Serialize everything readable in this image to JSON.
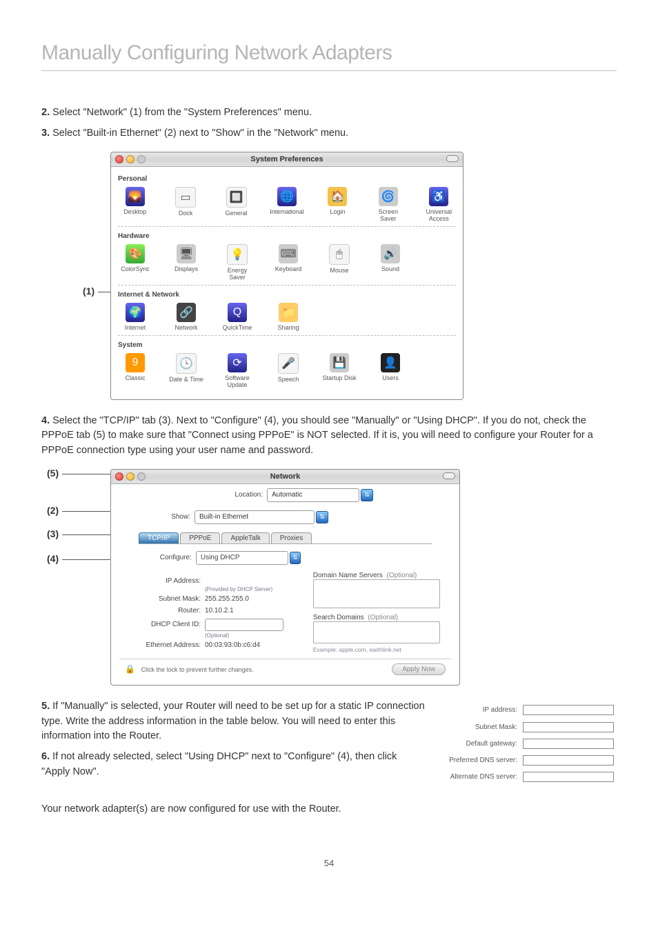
{
  "page": {
    "title": "Manually Configuring Network Adapters",
    "number": "54"
  },
  "steps": {
    "s2": {
      "num": "2.",
      "text": "Select \"Network\" (1) from the \"System Preferences\" menu."
    },
    "s3": {
      "num": "3.",
      "text": "Select \"Built-in Ethernet\" (2) next to \"Show\" in the \"Network\" menu."
    },
    "s4": {
      "num": "4.",
      "text": "Select the \"TCP/IP\" tab (3). Next to \"Configure\" (4), you should see \"Manually\" or \"Using DHCP\". If you do not, check the PPPoE tab (5) to make sure that \"Connect using PPPoE\" is NOT selected. If it is, you will need to configure your Router for a PPPoE connection type using your user name and password."
    },
    "s5": {
      "num": "5.",
      "text": "If \"Manually\" is selected, your Router will need to be set up for a static IP connection type. Write the address information in the table below. You will need to enter this information into the Router."
    },
    "s6": {
      "num": "6.",
      "text": "If not already selected, select \"Using DHCP\" next to \"Configure\" (4), then click \"Apply Now\"."
    },
    "closing": "Your network adapter(s) are now configured for use with the Router."
  },
  "callouts": {
    "c1": "(1)",
    "c2": "(2)",
    "c3": "(3)",
    "c4": "(4)",
    "c5": "(5)"
  },
  "sysprefs": {
    "title": "System Preferences",
    "categories": [
      {
        "title": "Personal",
        "items": [
          "Desktop",
          "Dock",
          "General",
          "International",
          "Login",
          "Screen Saver",
          "Universal Access"
        ]
      },
      {
        "title": "Hardware",
        "items": [
          "ColorSync",
          "Displays",
          "Energy Saver",
          "Keyboard",
          "Mouse",
          "Sound"
        ]
      },
      {
        "title": "Internet & Network",
        "items": [
          "Internet",
          "Network",
          "QuickTime",
          "Sharing"
        ]
      },
      {
        "title": "System",
        "items": [
          "Classic",
          "Date & Time",
          "Software Update",
          "Speech",
          "Startup Disk",
          "Users"
        ]
      }
    ]
  },
  "network": {
    "title": "Network",
    "location_label": "Location:",
    "location_value": "Automatic",
    "show_label": "Show:",
    "show_value": "Built-in Ethernet",
    "tabs": [
      "TCP/IP",
      "PPPoE",
      "AppleTalk",
      "Proxies"
    ],
    "configure_label": "Configure:",
    "configure_value": "Using DHCP",
    "ip_label": "IP Address:",
    "ip_note": "(Provided by DHCP Server)",
    "subnet_label": "Subnet Mask:",
    "subnet_value": "255.255.255.0",
    "router_label": "Router:",
    "router_value": "10.10.2.1",
    "dhcp_label": "DHCP Client ID:",
    "dhcp_note": "(Optional)",
    "mac_label": "Ethernet Address:",
    "mac_value": "00:03:93:0b:c6:d4",
    "dns_label": "Domain Name Servers",
    "dns_opt": "(Optional)",
    "search_label": "Search Domains",
    "search_opt": "(Optional)",
    "example": "Example: apple.com, earthlink.net",
    "lock_text": "Click the lock to prevent further changes.",
    "apply": "Apply Now"
  },
  "ipform": {
    "rows": [
      "IP address:",
      "Subnet Mask:",
      "Default gateway:",
      "Preferred DNS server:",
      "Alternate DNS server:"
    ]
  }
}
